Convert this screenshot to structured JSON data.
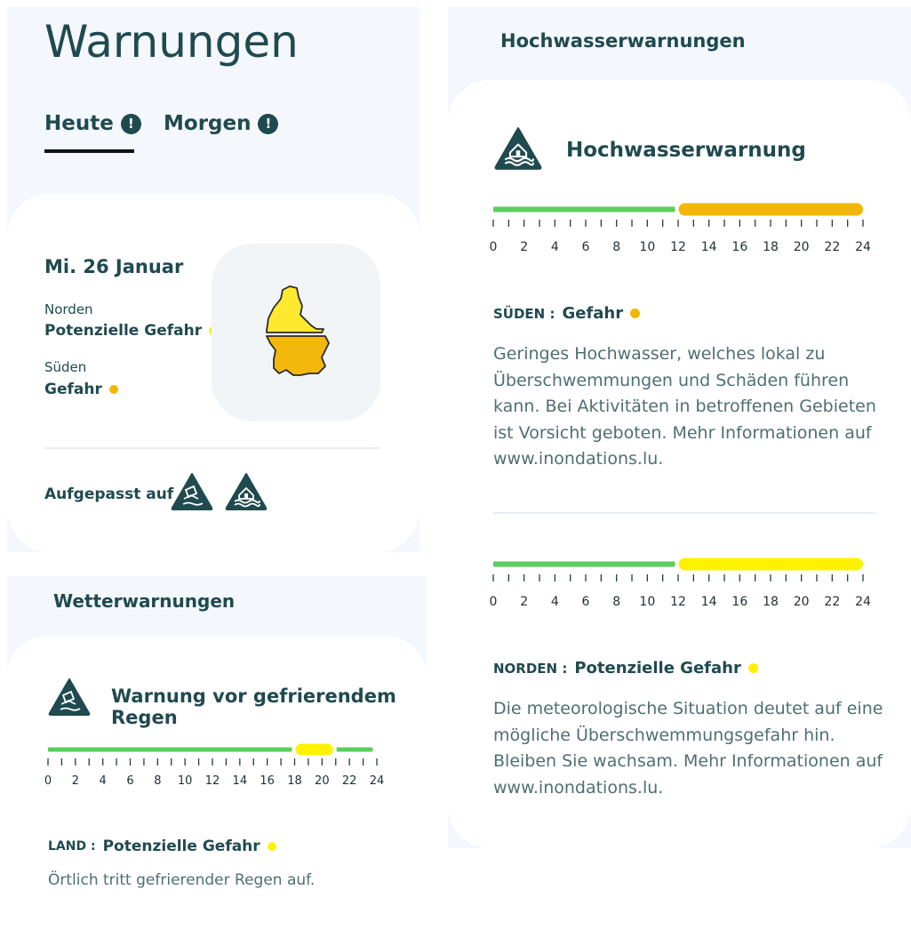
{
  "colors": {
    "text_dark": "#1f4a4f",
    "text_muted": "#4f6f72",
    "panel_bg": "#f4f8fc",
    "green": "#5acd5a",
    "orange": "#f2b705",
    "yellow": "#fff200",
    "map_north": "#ffe82e",
    "map_south": "#f4b70c"
  },
  "header": {
    "title": "Warnungen"
  },
  "tabs": [
    {
      "label": "Heute",
      "icon": "exclamation-circle-icon",
      "active": true
    },
    {
      "label": "Morgen",
      "icon": "exclamation-circle-icon",
      "active": false
    }
  ],
  "today": {
    "date": "Mi. 26 Januar",
    "regions": [
      {
        "name": "Norden",
        "level": "Potenzielle Gefahr",
        "level_color": "#fff200"
      },
      {
        "name": "Süden",
        "level": "Gefahr",
        "level_color": "#f2b705"
      }
    ],
    "map_icon": "luxembourg-map",
    "aware_label": "Aufgepasst auf",
    "aware_icons": [
      "freezing-rain-warning-icon",
      "flood-warning-icon"
    ]
  },
  "weather": {
    "section_title": "Wetterwarnungen",
    "warning_title": "Warnung vor gefrierendem Regen",
    "warning_icon": "freezing-rain-warning-icon",
    "timeline": {
      "hours": [
        0,
        2,
        4,
        6,
        8,
        10,
        12,
        14,
        16,
        18,
        20,
        22,
        24
      ],
      "segments": [
        {
          "from": 0,
          "to": 17.8,
          "level": "green"
        },
        {
          "from": 17.8,
          "to": 20.8,
          "level": "yellow"
        },
        {
          "from": 20.8,
          "to": 23.7,
          "level": "green"
        }
      ]
    },
    "region": {
      "key": "LAND :",
      "level": "Potenzielle Gefahr",
      "level_color": "#fff200"
    },
    "description": "Örtlich tritt gefrierender Regen auf."
  },
  "flood": {
    "section_title": "Hochwasserwarnungen",
    "warning_title": "Hochwasserwarnung",
    "warning_icon": "flood-warning-icon",
    "south": {
      "timeline": {
        "hours": [
          0,
          2,
          4,
          6,
          8,
          10,
          12,
          14,
          16,
          18,
          20,
          22,
          24
        ],
        "segments": [
          {
            "from": 0,
            "to": 11.8,
            "level": "green"
          },
          {
            "from": 11.8,
            "to": 24,
            "level": "orange"
          }
        ]
      },
      "key": "SÜDEN :",
      "level": "Gefahr",
      "level_color": "#f2b705",
      "description": "Geringes Hochwasser, welches lokal zu Überschwemmungen und Schäden führen kann. Bei Aktivitäten in betroffenen Gebieten ist Vorsicht geboten. Mehr Informationen auf www.inondations.lu."
    },
    "north": {
      "timeline": {
        "hours": [
          0,
          2,
          4,
          6,
          8,
          10,
          12,
          14,
          16,
          18,
          20,
          22,
          24
        ],
        "segments": [
          {
            "from": 0,
            "to": 11.8,
            "level": "green"
          },
          {
            "from": 11.8,
            "to": 24,
            "level": "yellow"
          }
        ]
      },
      "key": "NORDEN :",
      "level": "Potenzielle Gefahr",
      "level_color": "#fff200",
      "description": "Die meteorologische Situation deutet auf eine mögliche Überschwemmungsgefahr hin. Bleiben Sie wachsam. Mehr Informationen auf www.inondations.lu."
    }
  }
}
